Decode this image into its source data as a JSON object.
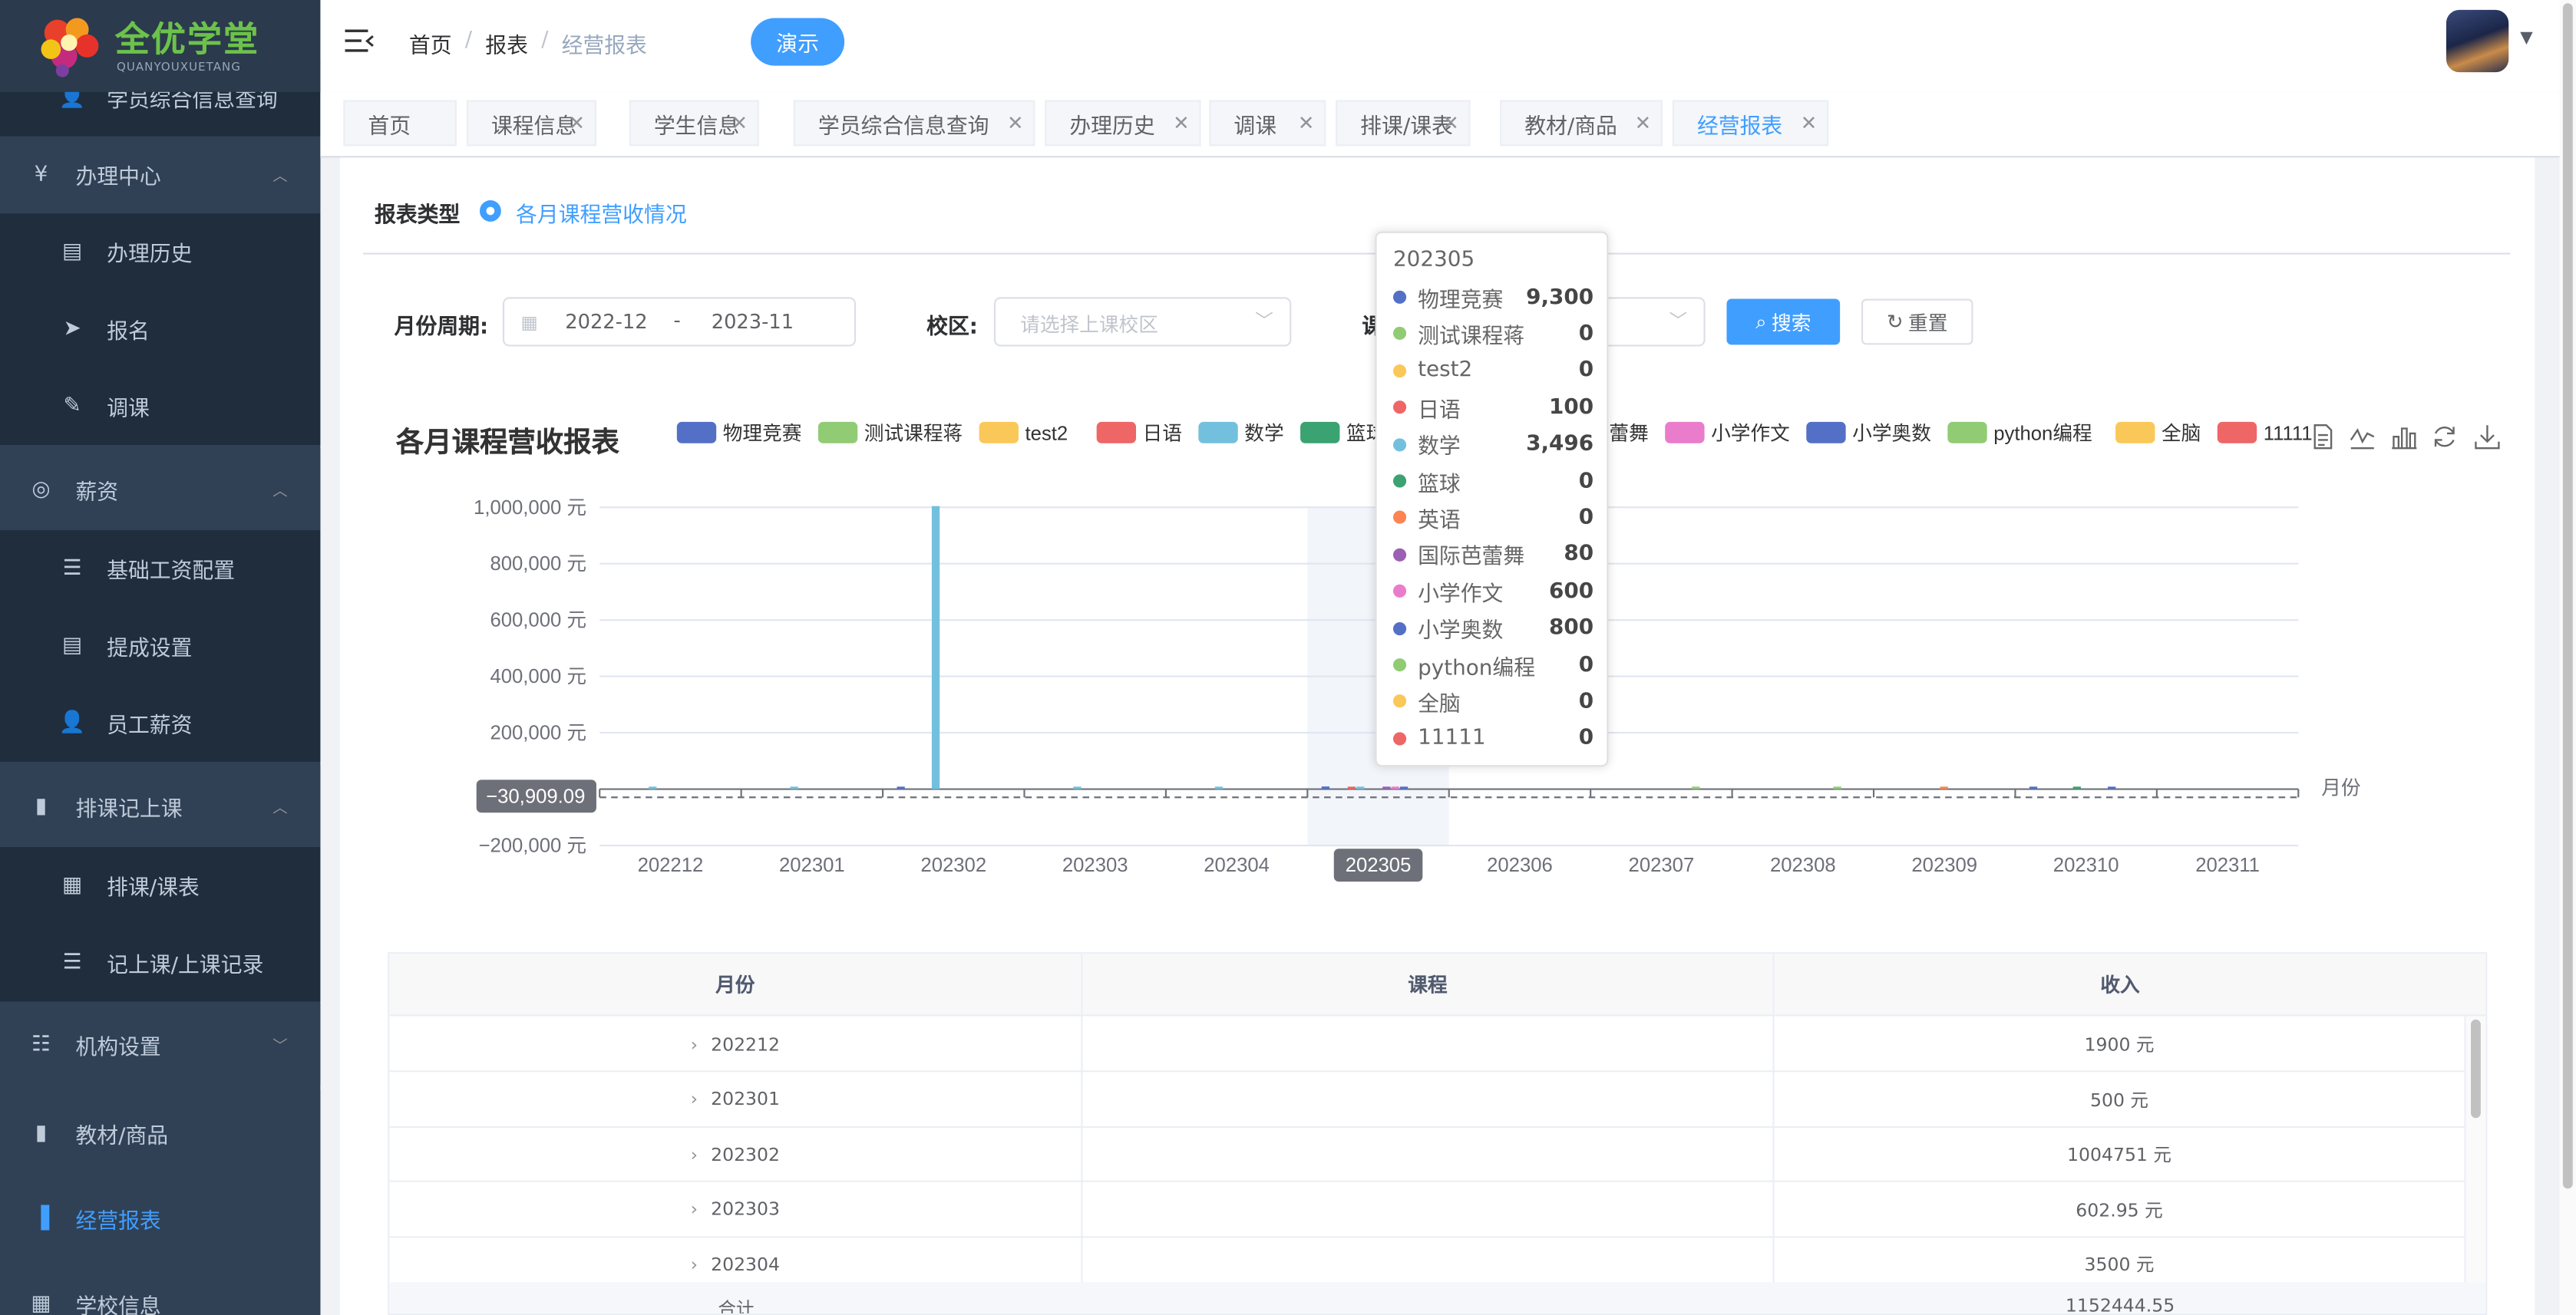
{
  "logo": {
    "title": "全优学堂",
    "subtitle": "QUANYOUXUETANG"
  },
  "sidebar": {
    "partial_item": "学员综合信息查询",
    "groups": [
      {
        "label": "办理中心",
        "icon": "yen-icon",
        "children": [
          {
            "label": "办理历史",
            "icon": "document-icon"
          },
          {
            "label": "报名",
            "icon": "send-icon"
          },
          {
            "label": "调课",
            "icon": "edit-icon"
          }
        ]
      },
      {
        "label": "薪资",
        "icon": "coins-icon",
        "children": [
          {
            "label": "基础工资配置",
            "icon": "list-icon"
          },
          {
            "label": "提成设置",
            "icon": "document-icon"
          },
          {
            "label": "员工薪资",
            "icon": "user-icon"
          }
        ]
      },
      {
        "label": "排课记上课",
        "icon": "book-icon",
        "children": [
          {
            "label": "排课/课表",
            "icon": "table-icon"
          },
          {
            "label": "记上课/上课记录",
            "icon": "list-icon"
          }
        ]
      }
    ],
    "tail": [
      {
        "label": "机构设置",
        "icon": "org-icon"
      },
      {
        "label": "教材/商品",
        "icon": "book-icon"
      },
      {
        "label": "经营报表",
        "icon": "bar-chart-icon",
        "active": true
      },
      {
        "label": "学校信息",
        "icon": "grid-icon"
      }
    ]
  },
  "navbar": {
    "breadcrumbs": [
      "首页",
      "报表",
      "经营报表"
    ],
    "separator": "/",
    "demo_label": "演示"
  },
  "tags": [
    {
      "label": "首页",
      "closable": false
    },
    {
      "label": "课程信息",
      "closable": true
    },
    {
      "label": "学生信息",
      "closable": true
    },
    {
      "label": "学员综合信息查询",
      "closable": true
    },
    {
      "label": "办理历史",
      "closable": true
    },
    {
      "label": "调课",
      "closable": true
    },
    {
      "label": "排课/课表",
      "closable": true
    },
    {
      "label": "教材/商品",
      "closable": true
    },
    {
      "label": "经营报表",
      "closable": true,
      "active": true
    }
  ],
  "filters": {
    "report_type_label": "报表类型",
    "report_type_value": "各月课程营收情况",
    "month_period_label": "月份周期:",
    "date_start": "2022-12",
    "date_sep": "-",
    "date_end": "2023-11",
    "campus_label": "校区:",
    "campus_placeholder": "请选择上课校区",
    "course_label_partial": "课",
    "search_label": "搜索",
    "reset_label": "重置"
  },
  "chart_data": {
    "type": "bar",
    "title": "各月课程营收报表",
    "xlabel": "月份",
    "ylabel": "",
    "y_unit": "元",
    "ylim": [
      -200000,
      1000000
    ],
    "yticks": [
      "1,000,000 元",
      "800,000 元",
      "600,000 元",
      "400,000 元",
      "200,000 元",
      "0 元",
      "−200,000 元"
    ],
    "categories": [
      "202212",
      "202301",
      "202302",
      "202303",
      "202304",
      "202305",
      "202306",
      "202307",
      "202308",
      "202309",
      "202310",
      "202311"
    ],
    "series": [
      {
        "name": "物理竞赛",
        "color": "#5470c6",
        "values": [
          0,
          0,
          500,
          0,
          0,
          9300,
          0,
          0,
          0,
          0,
          3000,
          0
        ]
      },
      {
        "name": "测试课程蒋",
        "color": "#91cc75",
        "values": [
          0,
          0,
          0,
          0,
          0,
          0,
          0,
          0,
          0,
          0,
          0,
          0
        ]
      },
      {
        "name": "test2",
        "color": "#fac858",
        "values": [
          0,
          0,
          0,
          0,
          0,
          0,
          0,
          0,
          0,
          0,
          0,
          0
        ]
      },
      {
        "name": "日语",
        "color": "#ee6666",
        "values": [
          0,
          0,
          0,
          0,
          0,
          100,
          0,
          0,
          0,
          0,
          0,
          0
        ]
      },
      {
        "name": "数学",
        "color": "#73c0de",
        "values": [
          1900,
          500,
          1004251,
          602.95,
          3500,
          3496,
          0,
          0,
          0,
          0,
          0,
          0
        ]
      },
      {
        "name": "篮球",
        "color": "#3ba272",
        "values": [
          0,
          0,
          0,
          0,
          0,
          0,
          0,
          0,
          0,
          0,
          4000,
          0
        ]
      },
      {
        "name": "英语",
        "color": "#fc8452",
        "values": [
          0,
          0,
          0,
          0,
          0,
          0,
          0,
          0,
          0,
          5000,
          0,
          0
        ]
      },
      {
        "name": "国际芭蕾舞",
        "color": "#9a60b4",
        "values": [
          0,
          0,
          0,
          0,
          0,
          80,
          0,
          0,
          0,
          0,
          0,
          0
        ]
      },
      {
        "name": "小学作文",
        "color": "#ea7ccc",
        "values": [
          0,
          0,
          0,
          0,
          0,
          600,
          0,
          0,
          0,
          0,
          0,
          0
        ]
      },
      {
        "name": "小学奥数",
        "color": "#5470c6",
        "values": [
          0,
          0,
          0,
          0,
          0,
          800,
          0,
          0,
          0,
          0,
          2500,
          0
        ]
      },
      {
        "name": "python编程",
        "color": "#91cc75",
        "values": [
          0,
          0,
          0,
          0,
          0,
          0,
          0,
          2500,
          2500,
          0,
          0,
          0
        ]
      },
      {
        "name": "全脑",
        "color": "#fac858",
        "values": [
          0,
          0,
          0,
          0,
          0,
          0,
          0,
          0,
          0,
          0,
          0,
          0
        ]
      },
      {
        "name": "11111",
        "color": "#ee6666",
        "values": [
          0,
          0,
          0,
          0,
          0,
          0,
          0,
          0,
          0,
          0,
          0,
          0
        ]
      }
    ],
    "axis_pointer_y_label": "−30,909.09",
    "highlighted_category": "202305",
    "legend_placement": "top",
    "grid": true
  },
  "tooltip": {
    "title": "202305",
    "rows": [
      {
        "name": "物理竞赛",
        "value": "9,300",
        "color": "#5470c6"
      },
      {
        "name": "测试课程蒋",
        "value": "0",
        "color": "#91cc75"
      },
      {
        "name": "test2",
        "value": "0",
        "color": "#fac858"
      },
      {
        "name": "日语",
        "value": "100",
        "color": "#ee6666"
      },
      {
        "name": "数学",
        "value": "3,496",
        "color": "#73c0de"
      },
      {
        "name": "篮球",
        "value": "0",
        "color": "#3ba272"
      },
      {
        "name": "英语",
        "value": "0",
        "color": "#fc8452"
      },
      {
        "name": "国际芭蕾舞",
        "value": "80",
        "color": "#9a60b4"
      },
      {
        "name": "小学作文",
        "value": "600",
        "color": "#ea7ccc"
      },
      {
        "name": "小学奥数",
        "value": "800",
        "color": "#5470c6"
      },
      {
        "name": "python编程",
        "value": "0",
        "color": "#91cc75"
      },
      {
        "name": "全脑",
        "value": "0",
        "color": "#fac858"
      },
      {
        "name": "11111",
        "value": "0",
        "color": "#ee6666"
      }
    ]
  },
  "table": {
    "headers": [
      "月份",
      "课程",
      "收入"
    ],
    "rows": [
      {
        "month": "202212",
        "course": "",
        "income": "1900 元"
      },
      {
        "month": "202301",
        "course": "",
        "income": "500 元"
      },
      {
        "month": "202302",
        "course": "",
        "income": "1004751 元"
      },
      {
        "month": "202303",
        "course": "",
        "income": "602.95 元"
      },
      {
        "month": "202304",
        "course": "",
        "income": "3500 元"
      }
    ],
    "sum_label": "合计",
    "sum_value": "1152444.55"
  }
}
